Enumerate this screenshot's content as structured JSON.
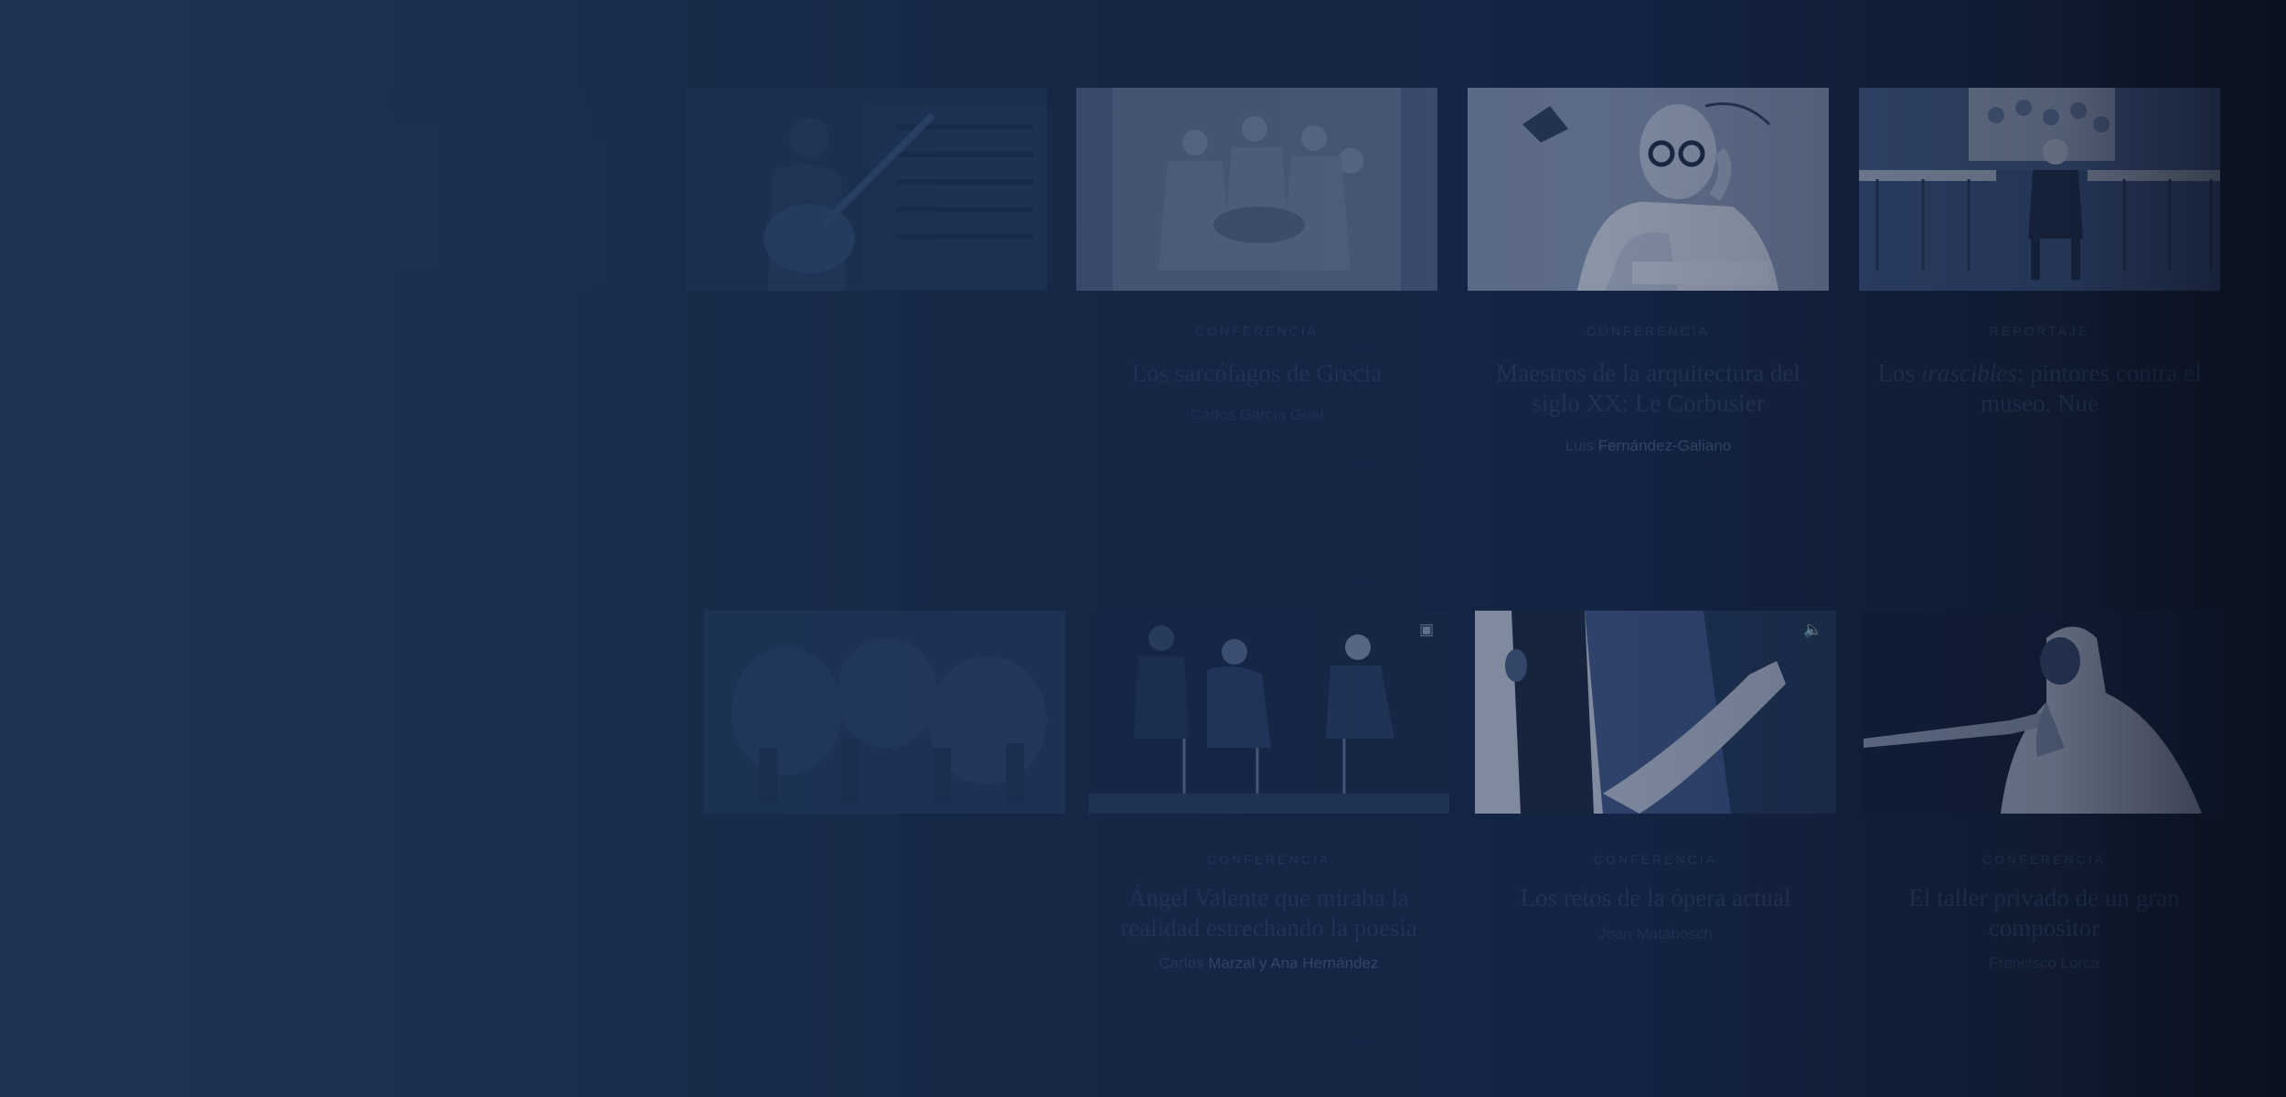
{
  "cards": [
    {
      "category": "",
      "title": "",
      "author": ""
    },
    {
      "category": "",
      "title": "",
      "author": ""
    },
    {
      "category": "Conferencia",
      "title": "Los sarcófagos de Grecia",
      "author": "Carlos García Gual"
    },
    {
      "category": "Conferencia",
      "title": "Maestros de la arquitectura del siglo XX: Le Corbusier",
      "author_lead": "Luis",
      "author_name": "Fernández-Galiano"
    },
    {
      "category": "Reportaje",
      "title_pre": "Los ",
      "title_italic": "irascibles",
      "title_post": ": pintores contra el museo. Nue",
      "author": ""
    },
    {
      "category": "",
      "title": "",
      "author": ""
    },
    {
      "category": "Conferencia",
      "title": "Ángel Valente que miraba la realidad estrechando la poesía",
      "author_lead": "Carlos",
      "author_name": "Marzal y Ana Hernández"
    },
    {
      "category": "Conferencia",
      "title": "Los retos de la ópera actual",
      "author": "Joan Matabosch",
      "media_icon": "speaker-icon"
    },
    {
      "category": "Conferencia",
      "title": "El taller privado de un gran compositor",
      "author": "Francisco Lorca"
    }
  ],
  "icons": {
    "video": "video-icon",
    "audio": "speaker-icon"
  },
  "colors": {
    "background": "#152745",
    "accent_dark": "#0c1424"
  }
}
